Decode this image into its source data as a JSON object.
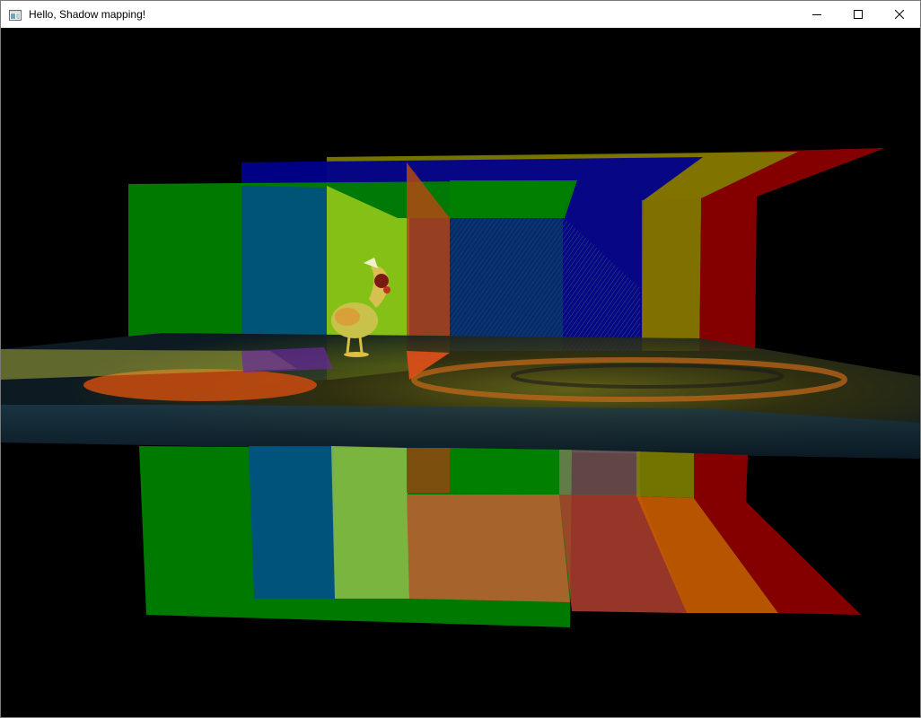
{
  "window": {
    "title": "Hello, Shadow mapping!",
    "icon": "app-window-icon"
  },
  "caption_buttons": [
    {
      "name": "minimize",
      "icon": "minimize-icon"
    },
    {
      "name": "maximize",
      "icon": "maximize-icon"
    },
    {
      "name": "close",
      "icon": "close-icon"
    }
  ],
  "scene": {
    "background": "#000000",
    "panel_colors": [
      "#008000",
      "#0000a0",
      "#a0c000",
      "#a00000"
    ]
  }
}
